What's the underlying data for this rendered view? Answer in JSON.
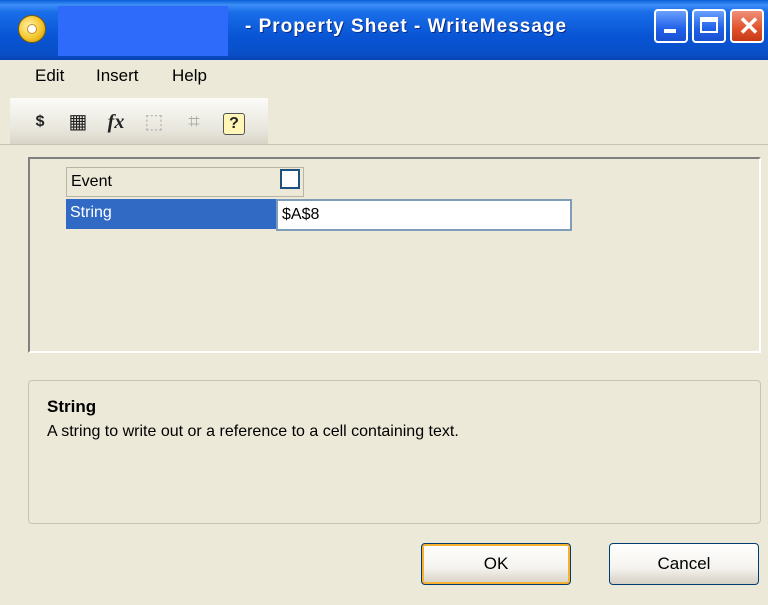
{
  "window": {
    "title": "- Property Sheet - WriteMessage",
    "minimize_icon": "minimize-icon",
    "maximize_icon": "maximize-icon",
    "close_icon": "close-icon",
    "close_glyph": "✕"
  },
  "menu": {
    "edit": "Edit",
    "insert": "Insert",
    "help": "Help"
  },
  "toolbar": {
    "cell_ref_glyph": "$",
    "range_glyph": "▦",
    "function_glyph": "fx",
    "select_glyph": "⬚",
    "select_range_glyph": "⌗",
    "help_glyph": "?"
  },
  "properties": {
    "rows": [
      {
        "label": "Event",
        "type": "checkbox",
        "checked": false
      },
      {
        "label": "String",
        "type": "text",
        "value": "$A$8"
      }
    ],
    "selected_color": "#316ac5"
  },
  "description": {
    "title": "String",
    "text": "A string to write out or a reference to a cell containing text."
  },
  "buttons": {
    "ok": "OK",
    "cancel": "Cancel"
  }
}
